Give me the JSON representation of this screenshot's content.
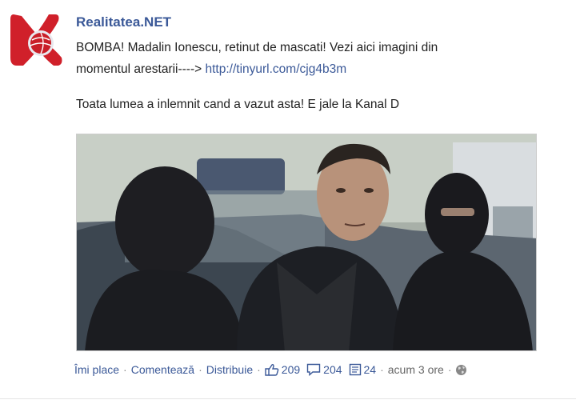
{
  "post": {
    "page_name": "Realitatea.NET",
    "message_line1": "BOMBA! Madalin Ionescu, retinut de mascati! Vezi aici imagini din",
    "message_line2": "momentul arestarii----> ",
    "link": "http://tinyurl.com/cjg4b3m",
    "message2": "Toata lumea a inlemnit cand a vazut asta! E jale la Kanal D"
  },
  "actions": {
    "like": "Îmi place",
    "comment": "Comentează",
    "share": "Distribuie",
    "likes_count": "209",
    "comments_count": "204",
    "shares_count": "24",
    "time": "acum 3 ore"
  },
  "icons": {
    "logo": "realitatea-logo",
    "like": "thumbs-up-icon",
    "comment": "comment-bubble-icon",
    "share": "share-doc-icon",
    "privacy": "globe-icon"
  },
  "colors": {
    "link": "#3b5998",
    "logo_red": "#d0202a"
  }
}
